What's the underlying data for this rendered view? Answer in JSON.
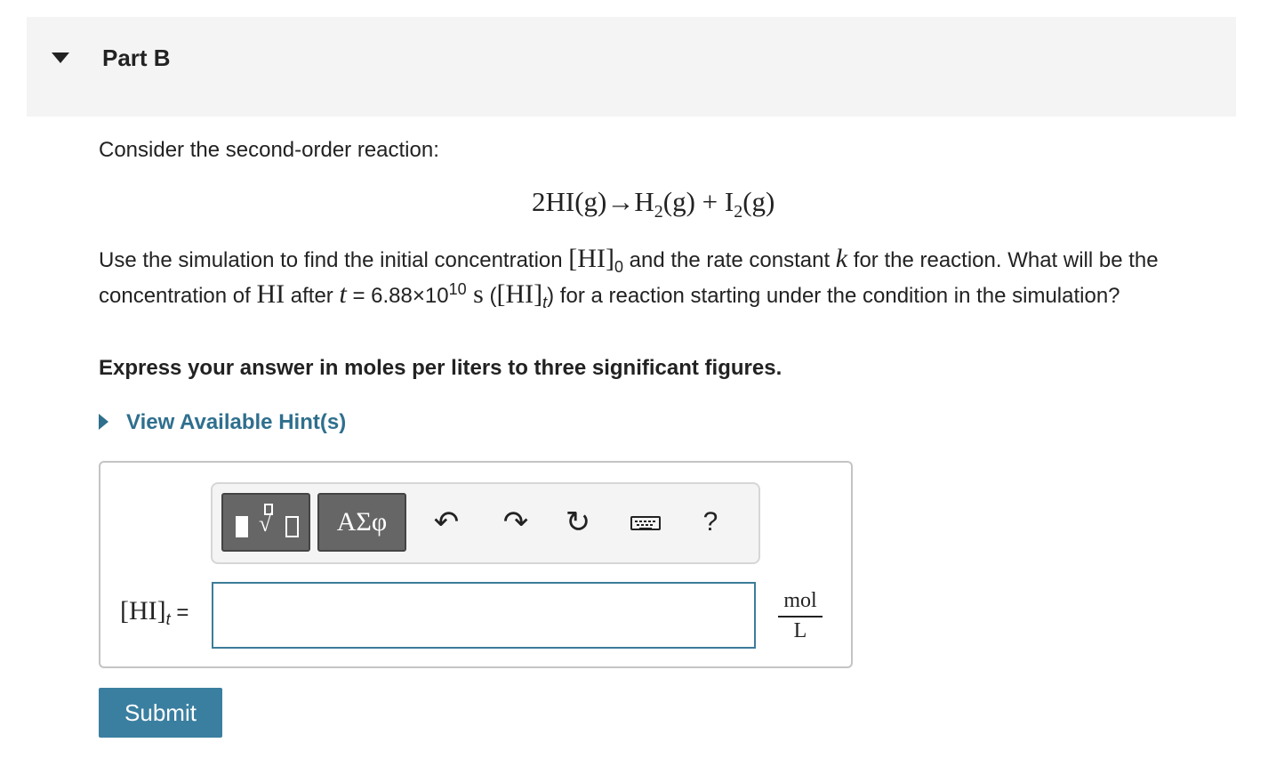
{
  "part": {
    "title": "Part B"
  },
  "intro": "Consider the second-order reaction:",
  "reaction": {
    "lhs": "2HI(g)",
    "arrow": "→",
    "p1": "H",
    "p1_sub": "2",
    "p1_state": "(g) + ",
    "p2": "I",
    "p2_sub": "2",
    "p2_state": "(g)"
  },
  "question": {
    "t1": "Use the simulation to find the initial concentration ",
    "hi0": "[HI]",
    "hi0_sub": "0",
    "t2": " and the rate constant ",
    "k": "k",
    "t3": " for the reaction. What will be the concentration of ",
    "hi": "HI",
    "t4": " after ",
    "t": "t",
    "t5": " = 6.88×10",
    "exp": "10",
    "s": " s",
    "t6": " (",
    "hit": "[HI]",
    "hit_sub": "t",
    "t7": ") for a reaction starting under the condition in the simulation?"
  },
  "instruction": "Express your answer in moles per liters to three significant figures.",
  "hint": {
    "label": "View Available Hint(s)"
  },
  "toolbar": {
    "greek_label": "ΑΣφ",
    "undo_glyph": "↶",
    "redo_glyph": "↷",
    "reset_glyph": "↻",
    "help_label": "?",
    "icons": [
      "templates-icon",
      "greek-symbols-icon",
      "undo-icon",
      "redo-icon",
      "reset-icon",
      "keyboard-icon",
      "help-icon"
    ]
  },
  "answer": {
    "label_main": "[HI]",
    "label_sub": "t",
    "label_eq": " = ",
    "value": "",
    "unit_num": "mol",
    "unit_den": "L"
  },
  "submit_label": "Submit"
}
